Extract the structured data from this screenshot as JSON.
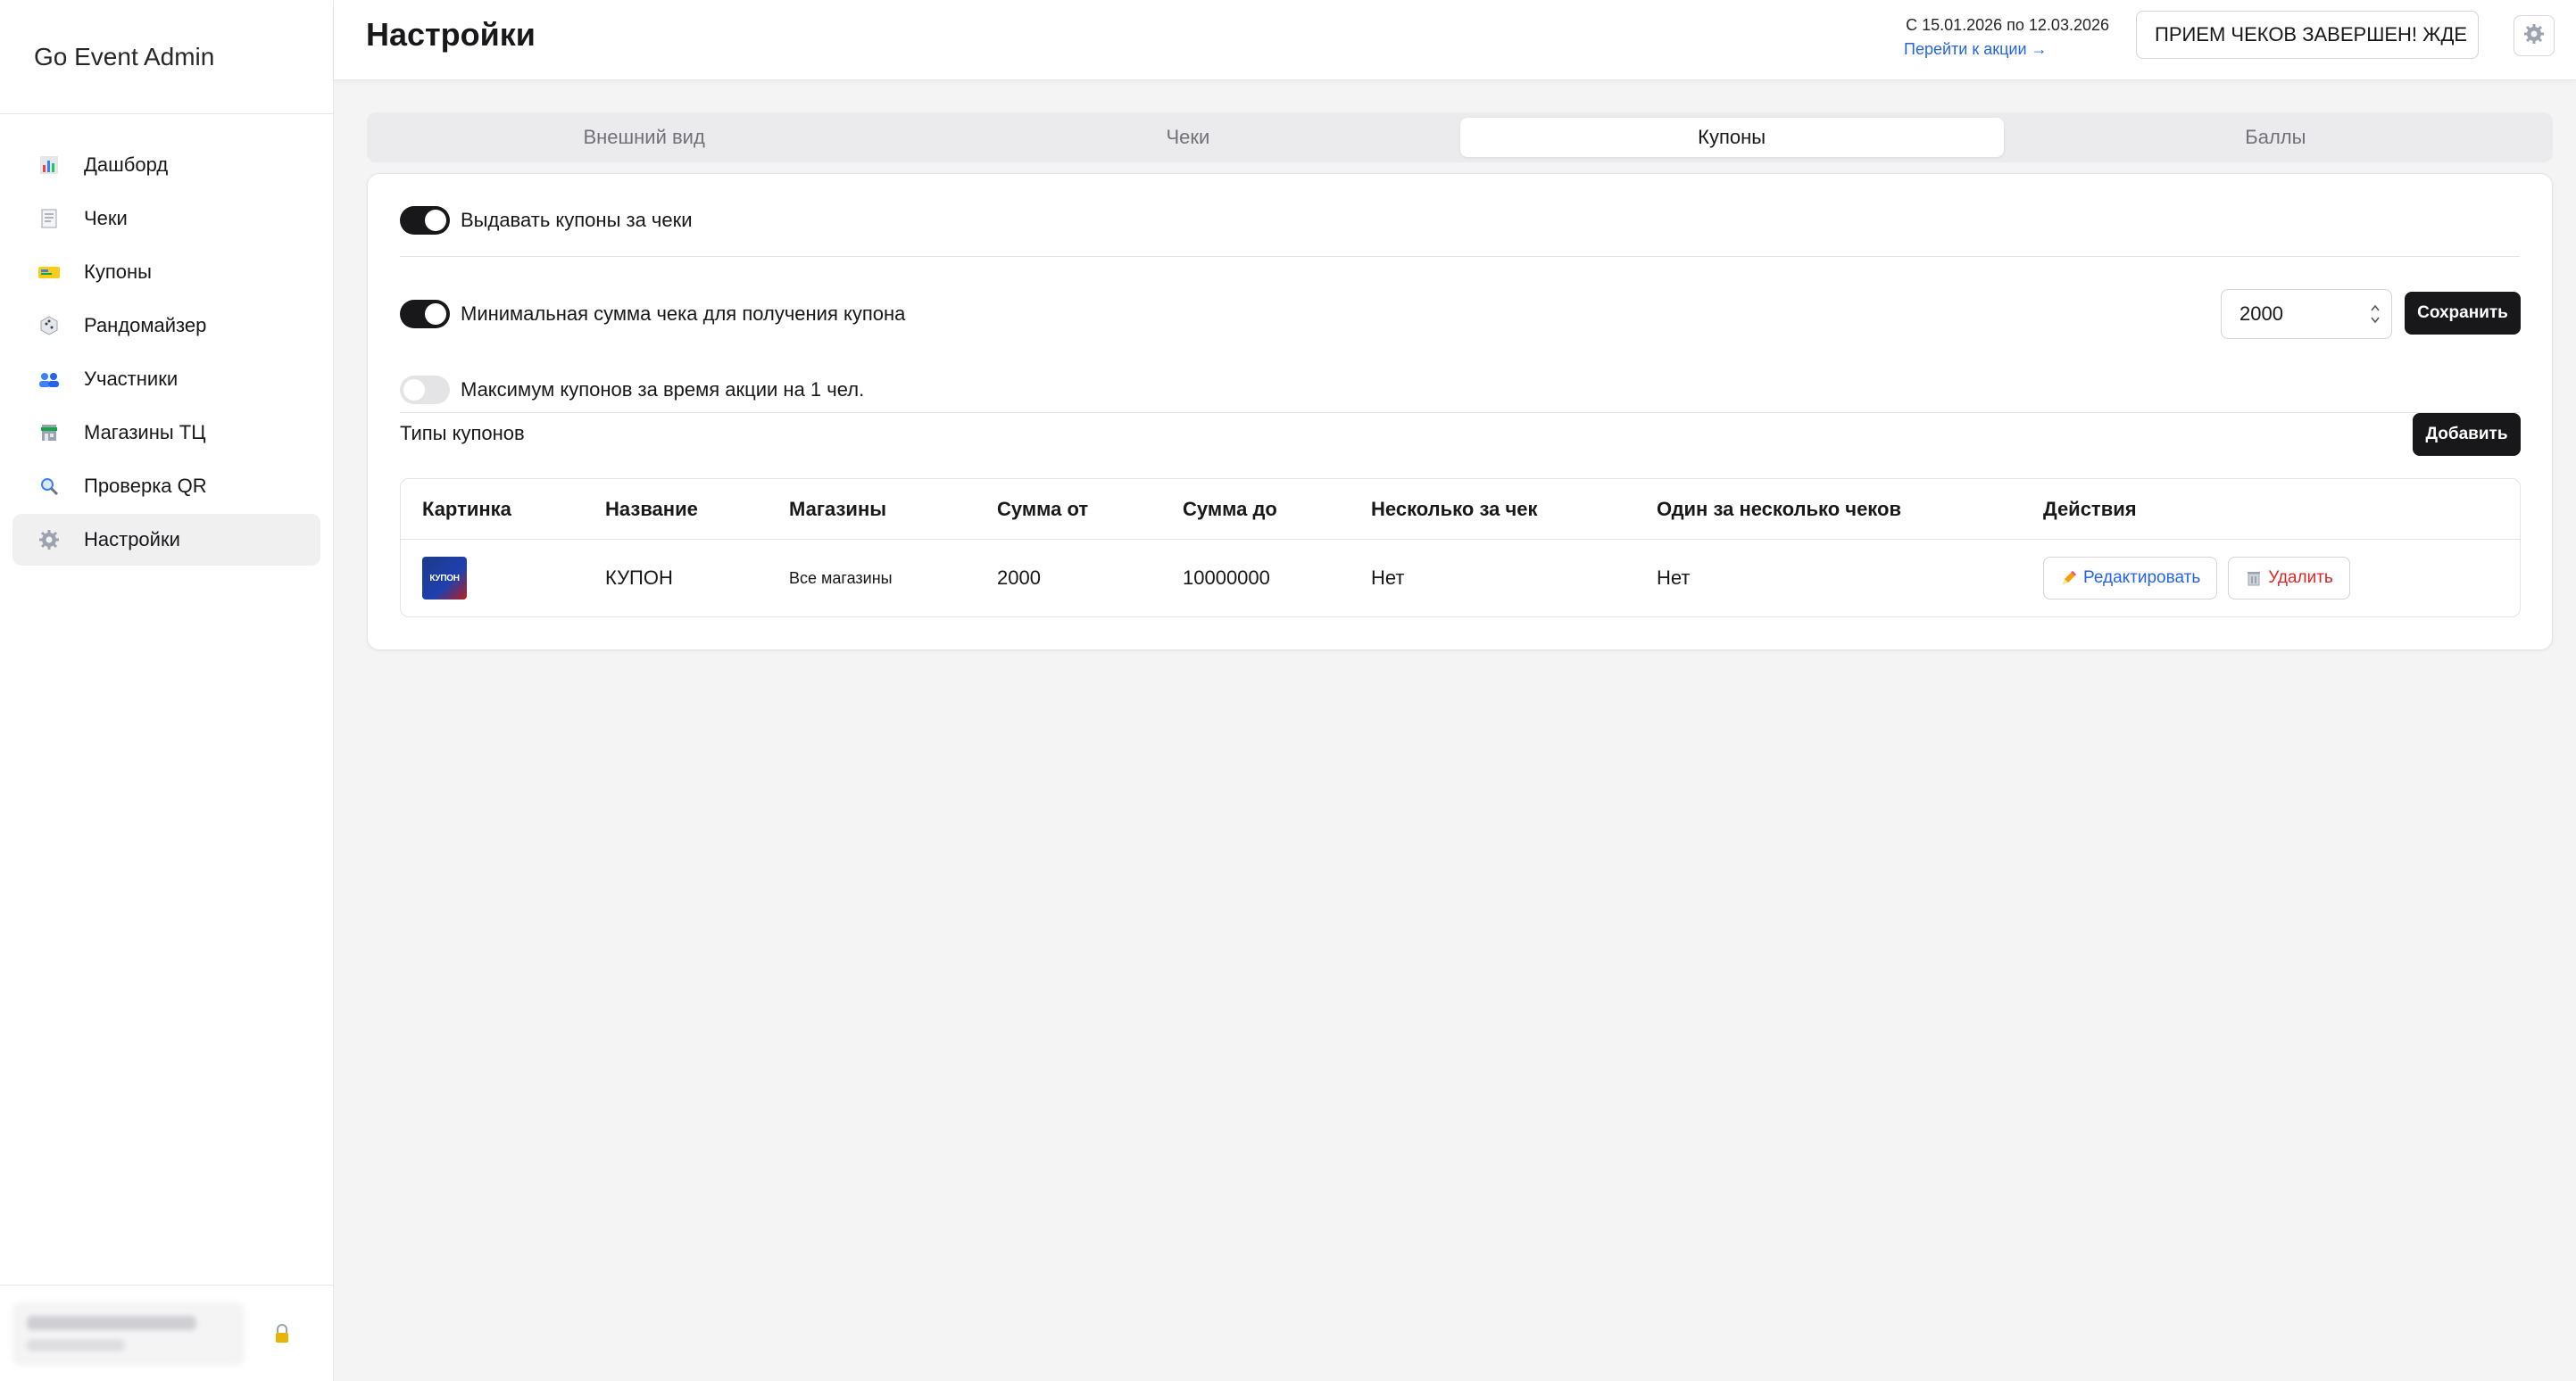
{
  "app": {
    "brand": "Go Event Admin"
  },
  "sidebar": {
    "items": [
      {
        "label": "Дашборд",
        "icon": "bar-chart-icon",
        "active": false
      },
      {
        "label": "Чеки",
        "icon": "receipt-icon",
        "active": false
      },
      {
        "label": "Купоны",
        "icon": "ticket-icon",
        "active": false
      },
      {
        "label": "Рандомайзер",
        "icon": "dice-icon",
        "active": false
      },
      {
        "label": "Участники",
        "icon": "users-icon",
        "active": false
      },
      {
        "label": "Магазины ТЦ",
        "icon": "store-icon",
        "active": false
      },
      {
        "label": "Проверка QR",
        "icon": "magnifier-icon",
        "active": false
      },
      {
        "label": "Настройки",
        "icon": "gear-icon",
        "active": true
      }
    ]
  },
  "header": {
    "title": "Настройки",
    "dates": "С 15.01.2026 по 12.03.2026",
    "promo_link": "Перейти к акции →",
    "status": "ПРИЕМ ЧЕКОВ ЗАВЕРШЕН! ЖДЕ"
  },
  "tabs": [
    {
      "label": "Внешний вид",
      "active": false
    },
    {
      "label": "Чеки",
      "active": false
    },
    {
      "label": "Купоны",
      "active": true
    },
    {
      "label": "Баллы",
      "active": false
    }
  ],
  "settings": {
    "issue_coupons": {
      "label": "Выдавать купоны за чеки",
      "on": true
    },
    "min_sum": {
      "label": "Минимальная сумма чека для получения купона",
      "on": true,
      "value": "2000"
    },
    "max_coupons": {
      "label": "Максимум купонов за время акции на 1 чел.",
      "on": false
    },
    "save_label": "Сохранить"
  },
  "coupon_types": {
    "title": "Типы купонов",
    "add_label": "Добавить",
    "columns": [
      "Картинка",
      "Название",
      "Магазины",
      "Сумма от",
      "Сумма до",
      "Несколько за чек",
      "Один за несколько чеков",
      "Действия"
    ],
    "rows": [
      {
        "image_text": "КУПОН",
        "name": "КУПОН",
        "stores": "Все магазины",
        "sum_from": "2000",
        "sum_to": "10000000",
        "multiple_per_receipt": "Нет",
        "one_per_many_receipts": "Нет",
        "edit_label": "Редактировать",
        "delete_label": "Удалить"
      }
    ]
  }
}
